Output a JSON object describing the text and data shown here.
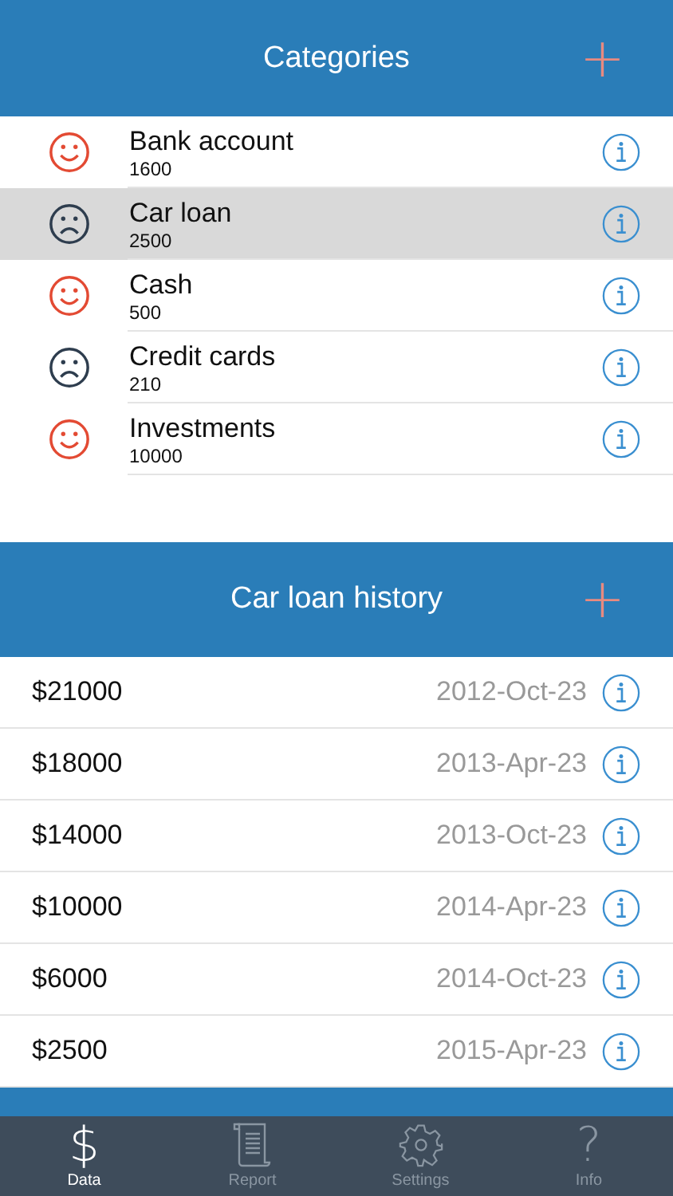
{
  "categories": {
    "title": "Categories",
    "add": "+",
    "items": [
      {
        "name": "Bank account",
        "amount": "1600",
        "kind": "happy",
        "selected": false
      },
      {
        "name": "Car loan",
        "amount": "2500",
        "kind": "sad",
        "selected": true
      },
      {
        "name": "Cash",
        "amount": "500",
        "kind": "happy",
        "selected": false
      },
      {
        "name": "Credit cards",
        "amount": "210",
        "kind": "sad",
        "selected": false
      },
      {
        "name": "Investments",
        "amount": "10000",
        "kind": "happy",
        "selected": false
      }
    ]
  },
  "history": {
    "title": "Car loan history",
    "add": "+",
    "rows": [
      {
        "value": "$21000",
        "date": "2012-Oct-23"
      },
      {
        "value": "$18000",
        "date": "2013-Apr-23"
      },
      {
        "value": "$14000",
        "date": "2013-Oct-23"
      },
      {
        "value": "$10000",
        "date": "2014-Apr-23"
      },
      {
        "value": "$6000",
        "date": "2014-Oct-23"
      },
      {
        "value": "$2500",
        "date": "2015-Apr-23"
      }
    ]
  },
  "tabs": [
    {
      "label": "Data",
      "kind": "glyph",
      "glyph": "$",
      "selected": true
    },
    {
      "label": "Report",
      "kind": "scroll",
      "selected": false
    },
    {
      "label": "Settings",
      "kind": "gear",
      "selected": false
    },
    {
      "label": "Info",
      "kind": "glyph",
      "glyph": "?",
      "selected": false
    }
  ]
}
